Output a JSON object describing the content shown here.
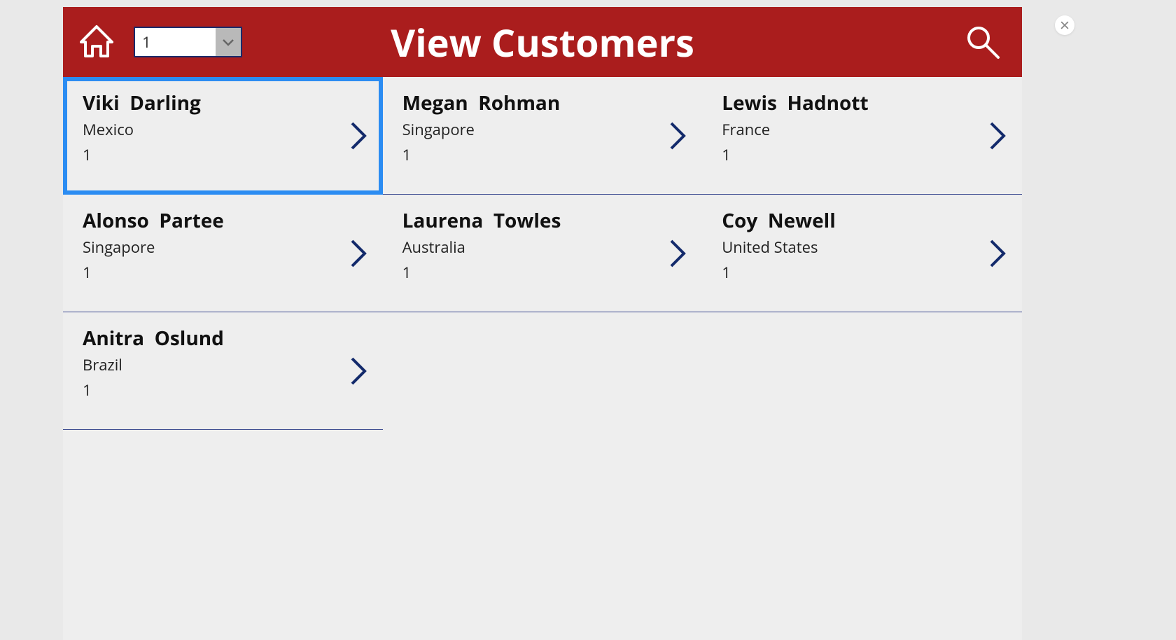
{
  "header": {
    "title": "View Customers",
    "page_selector_value": "1"
  },
  "customers": [
    {
      "name": "Viki  Darling",
      "country": "Mexico",
      "number": "1",
      "selected": true
    },
    {
      "name": "Megan  Rohman",
      "country": "Singapore",
      "number": "1",
      "selected": false
    },
    {
      "name": "Lewis  Hadnott",
      "country": "France",
      "number": "1",
      "selected": false
    },
    {
      "name": "Alonso  Partee",
      "country": "Singapore",
      "number": "1",
      "selected": false
    },
    {
      "name": "Laurena  Towles",
      "country": "Australia",
      "number": "1",
      "selected": false
    },
    {
      "name": "Coy  Newell",
      "country": "United States",
      "number": "1",
      "selected": false
    },
    {
      "name": "Anitra  Oslund",
      "country": "Brazil",
      "number": "1",
      "selected": false
    }
  ],
  "colors": {
    "header_bg": "#aa1d1d",
    "chevron": "#132a6b",
    "selection": "#2b8cf2"
  }
}
